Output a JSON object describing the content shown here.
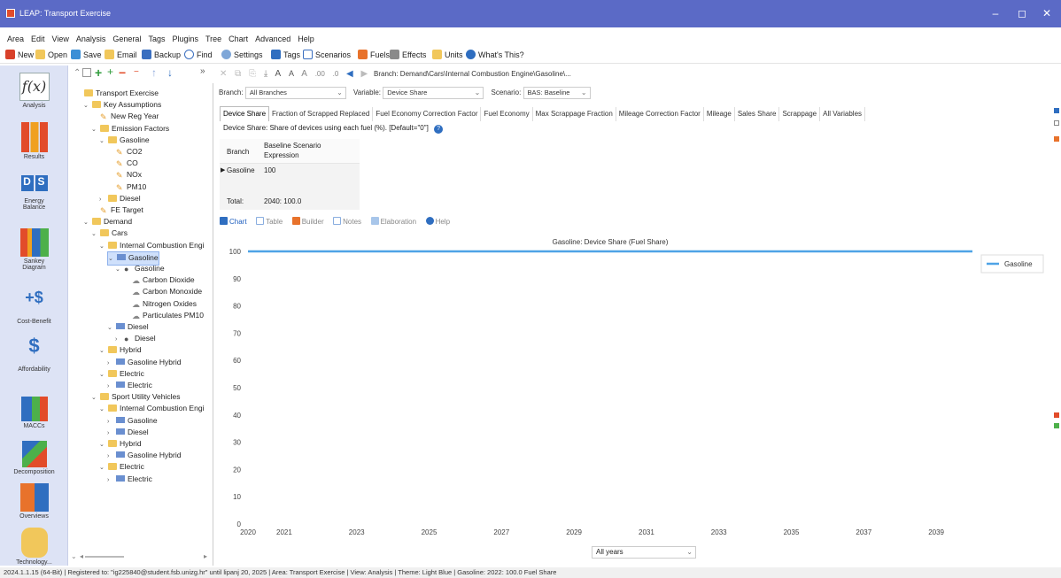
{
  "window": {
    "title": "LEAP: Transport Exercise",
    "minimize": "–",
    "maximize": "◻",
    "close": "✕"
  },
  "menu": [
    "Area",
    "Edit",
    "View",
    "Analysis",
    "General",
    "Tags",
    "Plugins",
    "Tree",
    "Chart",
    "Advanced",
    "Help"
  ],
  "toolbar": {
    "new": "New",
    "open": "Open",
    "save": "Save",
    "email": "Email",
    "backup": "Backup",
    "find": "Find",
    "settings": "Settings",
    "tags": "Tags",
    "scenarios": "Scenarios",
    "fuels": "Fuels",
    "effects": "Effects",
    "units": "Units",
    "whats_this": "What's This?"
  },
  "breadcrumb": "Branch: Demand\\Cars\\Internal Combustion Engine\\Gasoline\\...",
  "sidebar": [
    {
      "label": "Analysis",
      "icon": "analysis-icon"
    },
    {
      "label": "Results",
      "icon": "results-icon"
    },
    {
      "label": "Energy Balance",
      "icon": "energy-balance-icon"
    },
    {
      "label": "Sankey Diagram",
      "icon": "sankey-icon"
    },
    {
      "label": "Cost-Benefit",
      "icon": "cost-benefit-icon"
    },
    {
      "label": "Affordability",
      "icon": "affordability-icon"
    },
    {
      "label": "MACCs",
      "icon": "maccs-icon"
    },
    {
      "label": "Decomposition",
      "icon": "decomposition-icon"
    },
    {
      "label": "Overviews",
      "icon": "overviews-icon"
    },
    {
      "label": "Technology...",
      "icon": "technology-icon"
    }
  ],
  "tree": [
    {
      "label": "Transport Exercise",
      "type": "folder",
      "level": 0
    },
    {
      "label": "Key Assumptions",
      "type": "folder",
      "level": 1,
      "expander": "⌄"
    },
    {
      "label": "New Reg Year",
      "type": "key",
      "level": 2
    },
    {
      "label": "Emission Factors",
      "type": "folder",
      "level": 2,
      "expander": "⌄"
    },
    {
      "label": "Gasoline",
      "type": "folder",
      "level": 3,
      "expander": "⌄"
    },
    {
      "label": "CO2",
      "type": "key",
      "level": 4
    },
    {
      "label": "CO",
      "type": "key",
      "level": 4
    },
    {
      "label": "NOx",
      "type": "key",
      "level": 4
    },
    {
      "label": "PM10",
      "type": "key",
      "level": 4
    },
    {
      "label": "Diesel",
      "type": "folder",
      "level": 3,
      "expander": "›"
    },
    {
      "label": "FE Target",
      "type": "key",
      "level": 2
    },
    {
      "label": "Demand",
      "type": "folder",
      "level": 1,
      "expander": "⌄"
    },
    {
      "label": "Cars",
      "type": "folder",
      "level": 2,
      "expander": "⌄"
    },
    {
      "label": "Internal Combustion Engi",
      "type": "folder",
      "level": 3,
      "expander": "⌄"
    },
    {
      "label": "Gasoline",
      "type": "device",
      "level": 4,
      "expander": "⌄",
      "selected": true
    },
    {
      "label": "Gasoline",
      "type": "fuel",
      "level": 5,
      "expander": "⌄"
    },
    {
      "label": "Carbon Dioxide",
      "type": "effect",
      "level": 6
    },
    {
      "label": "Carbon Monoxide",
      "type": "effect",
      "level": 6
    },
    {
      "label": "Nitrogen Oxides",
      "type": "effect",
      "level": 6
    },
    {
      "label": "Particulates PM10",
      "type": "effect",
      "level": 6
    },
    {
      "label": "Diesel",
      "type": "device",
      "level": 4,
      "expander": "⌄"
    },
    {
      "label": "Diesel",
      "type": "fuel",
      "level": 5,
      "expander": "›"
    },
    {
      "label": "Hybrid",
      "type": "folder",
      "level": 3,
      "expander": "⌄"
    },
    {
      "label": "Gasoline Hybrid",
      "type": "device",
      "level": 4,
      "expander": "›"
    },
    {
      "label": "Electric",
      "type": "folder",
      "level": 3,
      "expander": "⌄"
    },
    {
      "label": "Electric",
      "type": "device",
      "level": 4,
      "expander": "›"
    },
    {
      "label": "Sport Utility Vehicles",
      "type": "folder",
      "level": 2,
      "expander": "⌄"
    },
    {
      "label": "Internal Combustion Engi",
      "type": "folder",
      "level": 3,
      "expander": "⌄"
    },
    {
      "label": "Gasoline",
      "type": "device",
      "level": 4,
      "expander": "›"
    },
    {
      "label": "Diesel",
      "type": "device",
      "level": 4,
      "expander": "›"
    },
    {
      "label": "Hybrid",
      "type": "folder",
      "level": 3,
      "expander": "⌄"
    },
    {
      "label": "Gasoline Hybrid",
      "type": "device",
      "level": 4,
      "expander": "›"
    },
    {
      "label": "Electric",
      "type": "folder",
      "level": 3,
      "expander": "⌄"
    },
    {
      "label": "Electric",
      "type": "device",
      "level": 4,
      "expander": "›"
    }
  ],
  "selectors": {
    "branch_label": "Branch:",
    "branch_value": "All Branches",
    "variable_label": "Variable:",
    "variable_value": "Device Share",
    "scenario_label": "Scenario:",
    "scenario_value": "BAS: Baseline"
  },
  "variable_tabs": [
    "Device Share",
    "Fraction of Scrapped Replaced",
    "Fuel Economy Correction Factor",
    "Fuel Economy",
    "Max Scrappage Fraction",
    "Mileage Correction Factor",
    "Mileage",
    "Sales Share",
    "Scrappage",
    "All Variables"
  ],
  "description": "Device Share: Share of devices using each fuel (%). [Default=\"0\"]",
  "grid": {
    "col_branch": "Branch",
    "col_expr_1": "Baseline Scenario",
    "col_expr_2": "Expression",
    "row_branch": "Gasoline",
    "row_value": "100",
    "total_label": "Total:",
    "total_value": "2040: 100.0"
  },
  "view_tabs": [
    "Chart",
    "Table",
    "Builder",
    "Notes",
    "Elaboration",
    "Help"
  ],
  "chart_data": {
    "type": "line",
    "title": "Gasoline: Device Share (Fuel Share)",
    "x": [
      2020,
      2021,
      2022,
      2023,
      2024,
      2025,
      2026,
      2027,
      2028,
      2029,
      2030,
      2031,
      2032,
      2033,
      2034,
      2035,
      2036,
      2037,
      2038,
      2039,
      2040
    ],
    "xticks": [
      "2020",
      "2021",
      "2023",
      "2025",
      "2027",
      "2029",
      "2031",
      "2033",
      "2035",
      "2037",
      "2039"
    ],
    "xtick_values": [
      2020,
      2021,
      2023,
      2025,
      2027,
      2029,
      2031,
      2033,
      2035,
      2037,
      2039
    ],
    "series": [
      {
        "name": "Gasoline",
        "values": [
          100,
          100,
          100,
          100,
          100,
          100,
          100,
          100,
          100,
          100,
          100,
          100,
          100,
          100,
          100,
          100,
          100,
          100,
          100,
          100,
          100
        ],
        "color": "#4ea3e6"
      }
    ],
    "ylim": [
      0,
      100
    ],
    "yticks": [
      0,
      10,
      20,
      30,
      40,
      50,
      60,
      70,
      80,
      90,
      100
    ],
    "legend": "right",
    "grid": false
  },
  "years_combo": "All years",
  "statusbar": "2024.1.1.15 (64-Bit) | Registered to: \"ig225840@student.fsb.unizg.hr\" until lipanj 20, 2025 | Area: Transport Exercise | View: Analysis | Theme: Light Blue | Gasoline: 2022: 100.0 Fuel Share"
}
